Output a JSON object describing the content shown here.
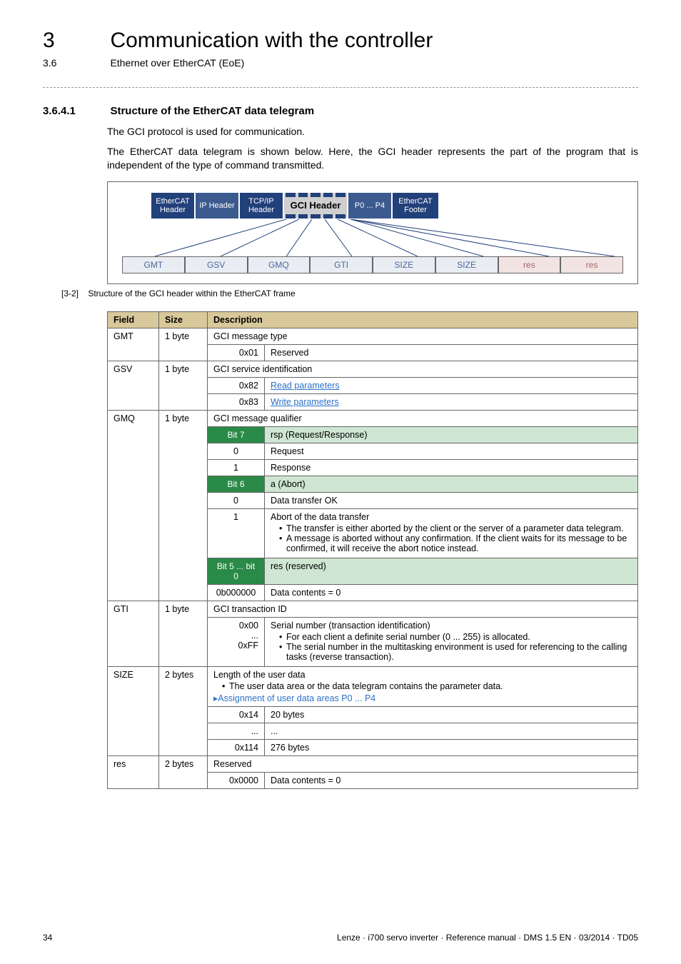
{
  "header": {
    "chapter_num": "3",
    "chapter_title": "Communication with the controller",
    "section_num": "3.6",
    "section_title": "Ethernet over EtherCAT (EoE)"
  },
  "subsection": {
    "num": "3.6.4.1",
    "title": "Structure of the EtherCAT data telegram"
  },
  "paragraphs": {
    "p1": "The GCI protocol is used for communication.",
    "p2": "The EtherCAT data telegram is shown below. Here, the GCI header represents the part of the program that is independent of the type of command transmitted."
  },
  "diagram": {
    "frame": {
      "ethercat_header": "EtherCAT\nHeader",
      "ip_header": "IP Header",
      "tcpip_header": "TCP/IP\nHeader",
      "gci_header": "GCI Header",
      "p0p4": "P0 ... P4",
      "ethercat_footer": "EtherCAT\nFooter"
    },
    "fields": [
      "GMT",
      "GSV",
      "GMQ",
      "GTI",
      "SIZE",
      "SIZE",
      "res",
      "res"
    ]
  },
  "caption": {
    "tag": "[3-2]",
    "text": "Structure of the GCI header within the EtherCAT frame"
  },
  "table": {
    "headers": {
      "field": "Field",
      "size": "Size",
      "desc": "Description"
    },
    "rows": {
      "gmt": {
        "field": "GMT",
        "size": "1 byte",
        "desc": "GCI message type",
        "sub": [
          {
            "val": "0x01",
            "text": "Reserved"
          }
        ]
      },
      "gsv": {
        "field": "GSV",
        "size": "1 byte",
        "desc": "GCI service identification",
        "sub": [
          {
            "val": "0x82",
            "link": "Read parameters"
          },
          {
            "val": "0x83",
            "link": "Write parameters"
          }
        ]
      },
      "gmq": {
        "field": "GMQ",
        "size": "1 byte",
        "desc": "GCI message qualifier",
        "bit7": {
          "hdr": "Bit 7",
          "hdr_desc": "rsp (Request/Response)",
          "rows": [
            {
              "val": "0",
              "text": "Request"
            },
            {
              "val": "1",
              "text": "Response"
            }
          ]
        },
        "bit6": {
          "hdr": "Bit 6",
          "hdr_desc": "a (Abort)",
          "rows": [
            {
              "val": "0",
              "text": "Data transfer OK"
            },
            {
              "val": "1",
              "text": "Abort of the data transfer",
              "bullets": [
                "The transfer is either aborted by the client or the server of a parameter data telegram.",
                "A message is aborted without any confirmation. If the client waits for its message to be confirmed, it will receive the abort notice instead."
              ]
            }
          ]
        },
        "bit50": {
          "hdr": "Bit 5 ... bit 0",
          "hdr_desc": "res (reserved)",
          "rows": [
            {
              "val": "0b000000",
              "text": "Data contents = 0"
            }
          ]
        }
      },
      "gti": {
        "field": "GTI",
        "size": "1 byte",
        "desc": "GCI transaction ID",
        "vals": [
          "0x00",
          "...",
          "0xFF"
        ],
        "text": "Serial number (transaction identification)",
        "bullets": [
          "For each client a definite serial number (0 ... 255) is allocated.",
          "The serial number in the multitasking environment is used for referencing to the calling tasks (reverse transaction)."
        ]
      },
      "size": {
        "field": "SIZE",
        "size": "2 bytes",
        "desc": "Length of the user data",
        "bullet": "The user data area or the data telegram contains the parameter data.",
        "link": "Assignment of user data areas P0 ... P4",
        "sub": [
          {
            "val": "0x14",
            "text": "20 bytes"
          },
          {
            "val": "...",
            "text": "..."
          },
          {
            "val": "0x114",
            "text": "276 bytes"
          }
        ]
      },
      "res": {
        "field": "res",
        "size": "2 bytes",
        "desc": "Reserved",
        "sub": [
          {
            "val": "0x0000",
            "text": "Data contents = 0"
          }
        ]
      }
    }
  },
  "footer": {
    "page": "34",
    "right": "Lenze · i700 servo inverter · Reference manual · DMS 1.5 EN · 03/2014 · TD05"
  }
}
